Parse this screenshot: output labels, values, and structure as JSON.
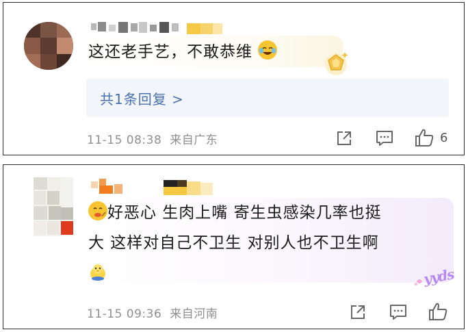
{
  "comments": [
    {
      "text": "这还老手艺，不敢恭维",
      "reply_link": "共1条回复 >",
      "timestamp": "11-15 08:38",
      "location": "来自广东",
      "like_count": "6",
      "inline_emoji": "laughing-crying-emoji",
      "badge_icon": "gold-medal-badge-icon"
    },
    {
      "text_line1": "好恶心 生肉上嘴 寄生虫感染几率也挺",
      "text_line2": "大 这样对自己不卫生 对别人也不卫生啊",
      "timestamp": "11-15 09:36",
      "location": "来自河南",
      "leading_emoji": "eating-emoji",
      "trailing_emoji": "chick-emoji",
      "sticker_text": "yyds"
    }
  ],
  "colors": {
    "reply_link": "#4a6fae",
    "meta_text": "#8f8f8f",
    "reply_bg": "#f2f5fa"
  }
}
